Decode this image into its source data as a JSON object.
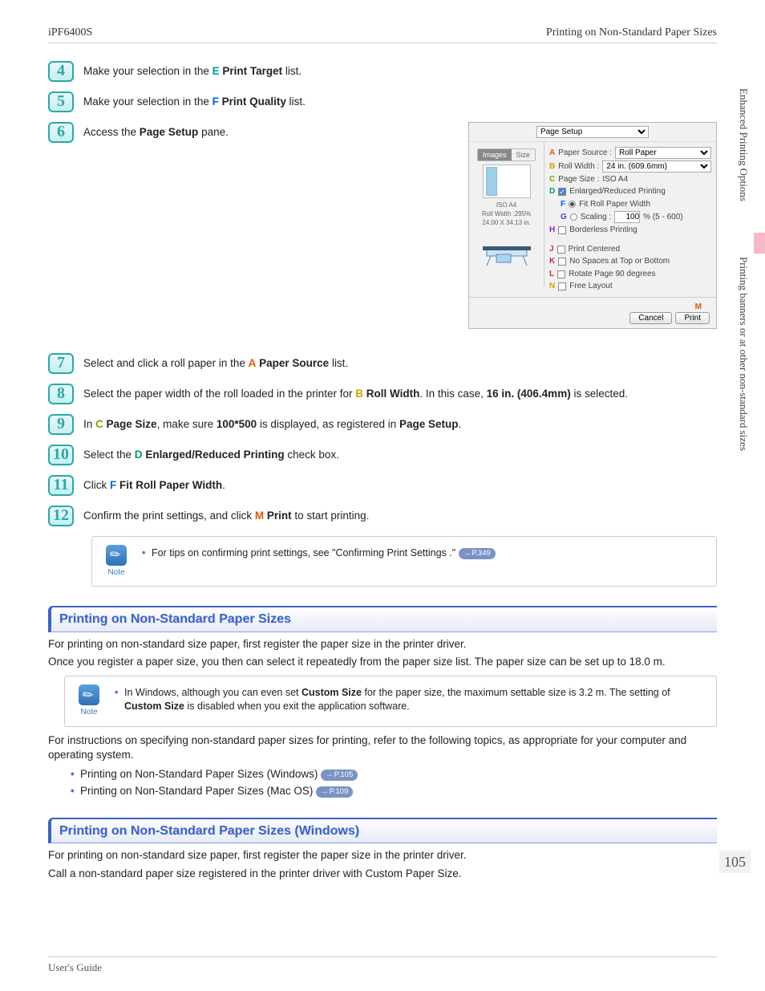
{
  "header": {
    "left": "iPF6400S",
    "right": "Printing on Non-Standard Paper Sizes"
  },
  "sidebar": {
    "group1": "Enhanced Printing Options",
    "group2": "Printing banners or at other non-standard sizes"
  },
  "steps": {
    "s4": {
      "num": "4",
      "pre": "Make your selection in the ",
      "mark": "E",
      "bold": "Print Target",
      "post": " list."
    },
    "s5": {
      "num": "5",
      "pre": "Make your selection in the ",
      "mark": "F",
      "bold": "Print Quality",
      "post": " list."
    },
    "s6": {
      "num": "6",
      "pre": "Access the ",
      "bold": "Page Setup",
      "post": " pane."
    },
    "s7": {
      "num": "7",
      "pre": "Select and click a roll paper in the ",
      "mark": "A",
      "bold": "Paper Source",
      "post": " list."
    },
    "s8": {
      "num": "8",
      "pre": "Select the paper width of the roll loaded in the printer for ",
      "mark": "B",
      "bold": "Roll Width",
      "mid": ". In this case, ",
      "bold2": "16 in. (406.4mm)",
      "post": " is selected."
    },
    "s9": {
      "num": "9",
      "pre": "In ",
      "mark": "C",
      "bold": "Page Size",
      "mid": ", make sure ",
      "bold2": "100*500",
      "mid2": " is displayed, as registered in ",
      "bold3": "Page Setup",
      "post": "."
    },
    "s10": {
      "num": "10",
      "pre": "Select the ",
      "mark": "D",
      "bold": "Enlarged/Reduced Printing",
      "post": " check box."
    },
    "s11": {
      "num": "11",
      "pre": "Click ",
      "mark": "F",
      "bold": "Fit Roll Paper Width",
      "post": "."
    },
    "s12": {
      "num": "12",
      "pre": "Confirm the print settings, and click ",
      "mark": "M",
      "bold": "Print",
      "post": " to start printing."
    }
  },
  "note1": {
    "text": "For tips on confirming print settings, see \"Confirming Print Settings .\" ",
    "pill": "P.349",
    "label": "Note"
  },
  "section1": {
    "title": "Printing on Non-Standard Paper Sizes",
    "p1": "For printing on non-standard size paper, first register the paper size in the printer driver.",
    "p2": "Once you register a paper size, you then can select it repeatedly from the paper size list. The paper size can be set up to 18.0 m."
  },
  "note2": {
    "pre": "In Windows, although you can even set ",
    "b1": "Custom Size",
    "mid": " for the paper size, the maximum settable size is 3.2 m. The setting of ",
    "b2": "Custom Size",
    "post": " is disabled when you exit the application software.",
    "label": "Note"
  },
  "section1b": "For instructions on specifying non-standard paper sizes for printing, refer to the following topics, as appropriate for your computer and operating system.",
  "links": {
    "l1": {
      "text": "Printing on Non-Standard Paper Sizes (Windows) ",
      "pill": "P.105"
    },
    "l2": {
      "text": "Printing on Non-Standard Paper Sizes (Mac OS) ",
      "pill": "P.109"
    }
  },
  "section2": {
    "title": "Printing on Non-Standard Paper Sizes (Windows)",
    "p1": "For printing on non-standard size paper, first register the paper size in the printer driver.",
    "p2": "Call a non-standard paper size registered in the printer driver with Custom Paper Size."
  },
  "pagenum": "105",
  "footer": "User's Guide",
  "dialog": {
    "top": "Page Setup",
    "tab1": "Images",
    "tab2": "Size",
    "paperInfo1": "ISO A4",
    "paperInfo2": "Roll Width :295%",
    "paperInfo3": "24.00 X 34.13 in.",
    "A": "A",
    "Alabel": "Paper Source :",
    "Aval": "Roll Paper",
    "B": "B",
    "Blabel": "Roll Width :",
    "Bval": "24 in. (609.6mm)",
    "C": "C",
    "Clabel": "Page Size :",
    "Cval": "ISO A4",
    "D": "D",
    "Dlabel": "Enlarged/Reduced Printing",
    "F": "F",
    "Flabel": "Fit Roll Paper Width",
    "G": "G",
    "Glabel": "Scaling :",
    "Gval": "100",
    "Grange": "% (5 - 600)",
    "H": "H",
    "Hlabel": "Borderless Printing",
    "J": "J",
    "Jlabel": "Print Centered",
    "K": "K",
    "Klabel": "No Spaces at Top or Bottom",
    "L": "L",
    "Llabel": "Rotate Page 90 degrees",
    "N": "N",
    "Nlabel": "Free Layout",
    "M": "M",
    "cancel": "Cancel",
    "print": "Print"
  }
}
